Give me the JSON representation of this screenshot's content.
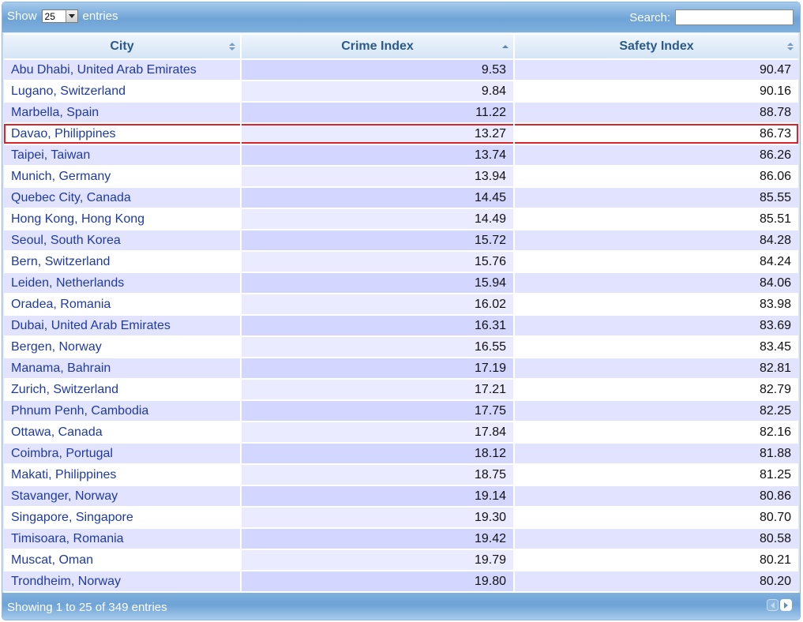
{
  "toolbar": {
    "show_label": "Show",
    "entries_label": "entries",
    "page_length": "25",
    "search_label": "Search:",
    "search_value": ""
  },
  "columns": [
    "City",
    "Crime Index",
    "Safety Index"
  ],
  "rows": [
    {
      "city": "Abu Dhabi, United Arab Emirates",
      "crime": "9.53",
      "safety": "90.47"
    },
    {
      "city": "Lugano, Switzerland",
      "crime": "9.84",
      "safety": "90.16"
    },
    {
      "city": "Marbella, Spain",
      "crime": "11.22",
      "safety": "88.78"
    },
    {
      "city": "Davao, Philippines",
      "crime": "13.27",
      "safety": "86.73"
    },
    {
      "city": "Taipei, Taiwan",
      "crime": "13.74",
      "safety": "86.26"
    },
    {
      "city": "Munich, Germany",
      "crime": "13.94",
      "safety": "86.06"
    },
    {
      "city": "Quebec City, Canada",
      "crime": "14.45",
      "safety": "85.55"
    },
    {
      "city": "Hong Kong, Hong Kong",
      "crime": "14.49",
      "safety": "85.51"
    },
    {
      "city": "Seoul, South Korea",
      "crime": "15.72",
      "safety": "84.28"
    },
    {
      "city": "Bern, Switzerland",
      "crime": "15.76",
      "safety": "84.24"
    },
    {
      "city": "Leiden, Netherlands",
      "crime": "15.94",
      "safety": "84.06"
    },
    {
      "city": "Oradea, Romania",
      "crime": "16.02",
      "safety": "83.98"
    },
    {
      "city": "Dubai, United Arab Emirates",
      "crime": "16.31",
      "safety": "83.69"
    },
    {
      "city": "Bergen, Norway",
      "crime": "16.55",
      "safety": "83.45"
    },
    {
      "city": "Manama, Bahrain",
      "crime": "17.19",
      "safety": "82.81"
    },
    {
      "city": "Zurich, Switzerland",
      "crime": "17.21",
      "safety": "82.79"
    },
    {
      "city": "Phnum Penh, Cambodia",
      "crime": "17.75",
      "safety": "82.25"
    },
    {
      "city": "Ottawa, Canada",
      "crime": "17.84",
      "safety": "82.16"
    },
    {
      "city": "Coimbra, Portugal",
      "crime": "18.12",
      "safety": "81.88"
    },
    {
      "city": "Makati, Philippines",
      "crime": "18.75",
      "safety": "81.25"
    },
    {
      "city": "Stavanger, Norway",
      "crime": "19.14",
      "safety": "80.86"
    },
    {
      "city": "Singapore, Singapore",
      "crime": "19.30",
      "safety": "80.70"
    },
    {
      "city": "Timisoara, Romania",
      "crime": "19.42",
      "safety": "80.58"
    },
    {
      "city": "Muscat, Oman",
      "crime": "19.79",
      "safety": "80.21"
    },
    {
      "city": "Trondheim, Norway",
      "crime": "19.80",
      "safety": "80.20"
    }
  ],
  "footer": {
    "info": "Showing 1 to 25 of 349 entries"
  },
  "colors": {
    "highlight_border": "#d7262e",
    "city_link": "#1f3aa6",
    "header_text": "#2b5a8a"
  }
}
